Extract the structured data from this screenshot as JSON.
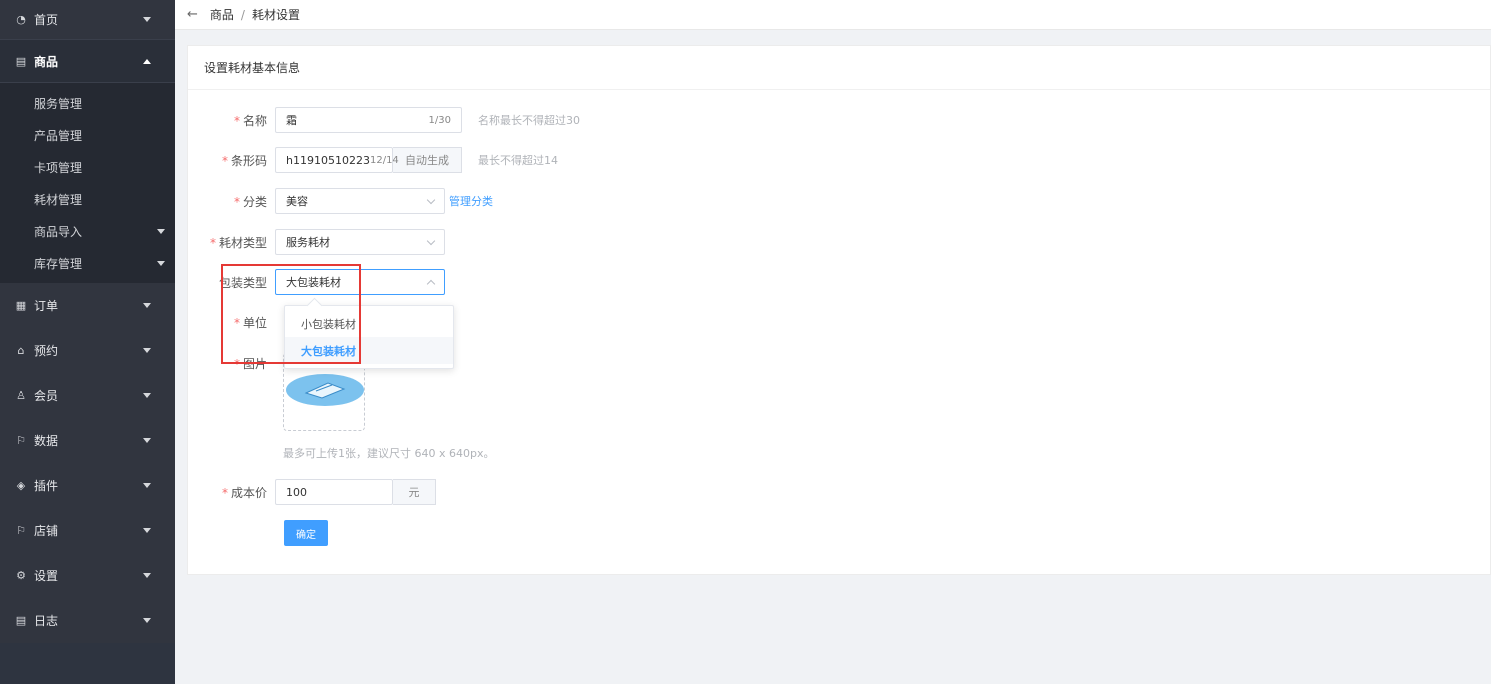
{
  "sidebar": {
    "home": {
      "label": "首页",
      "icon": "dashboard-icon"
    },
    "goods": {
      "label": "商品",
      "icon": "document-icon",
      "items": [
        {
          "label": "服务管理"
        },
        {
          "label": "产品管理"
        },
        {
          "label": "卡项管理"
        },
        {
          "label": "耗材管理"
        },
        {
          "label": "商品导入"
        },
        {
          "label": "库存管理"
        }
      ]
    },
    "groups": [
      {
        "label": "订单",
        "icon": "order-icon"
      },
      {
        "label": "预约",
        "icon": "home-icon"
      },
      {
        "label": "会员",
        "icon": "user-icon"
      },
      {
        "label": "数据",
        "icon": "flag-icon"
      },
      {
        "label": "插件",
        "icon": "cube-icon"
      },
      {
        "label": "店铺",
        "icon": "flag-icon"
      },
      {
        "label": "设置",
        "icon": "gear-icon"
      },
      {
        "label": "日志",
        "icon": "log-icon"
      }
    ]
  },
  "topbar": {
    "back_icon": "←",
    "crumb1": "商品",
    "sep": "/",
    "crumb2": "耗材设置"
  },
  "card": {
    "title": "设置耗材基本信息"
  },
  "form": {
    "name": {
      "label": "名称",
      "value": "霜",
      "count": "1/30",
      "hint": "名称最长不得超过30"
    },
    "barcode": {
      "label": "条形码",
      "value": "h11910510223",
      "count": "12/14",
      "button": "自动生成",
      "hint": "最长不得超过14"
    },
    "category": {
      "label": "分类",
      "value": "美容",
      "link": "管理分类"
    },
    "consumable_type": {
      "label": "耗材类型",
      "value": "服务耗材"
    },
    "package_type": {
      "label": "包装类型",
      "value": "大包装耗材"
    },
    "unit": {
      "label": "单位"
    },
    "image": {
      "label": "图片",
      "hint": "最多可上传1张，建议尺寸 640 x 640px。"
    },
    "cost": {
      "label": "成本价",
      "value": "100",
      "suffix": "元"
    },
    "submit": "确定"
  },
  "dropdown": {
    "options": [
      {
        "label": "小包装耗材",
        "selected": false
      },
      {
        "label": "大包装耗材",
        "selected": true
      }
    ]
  },
  "colors": {
    "primary": "#409eff",
    "required": "#f56c6c",
    "highlight": "#e53935",
    "sidebar": "#2e3440"
  }
}
